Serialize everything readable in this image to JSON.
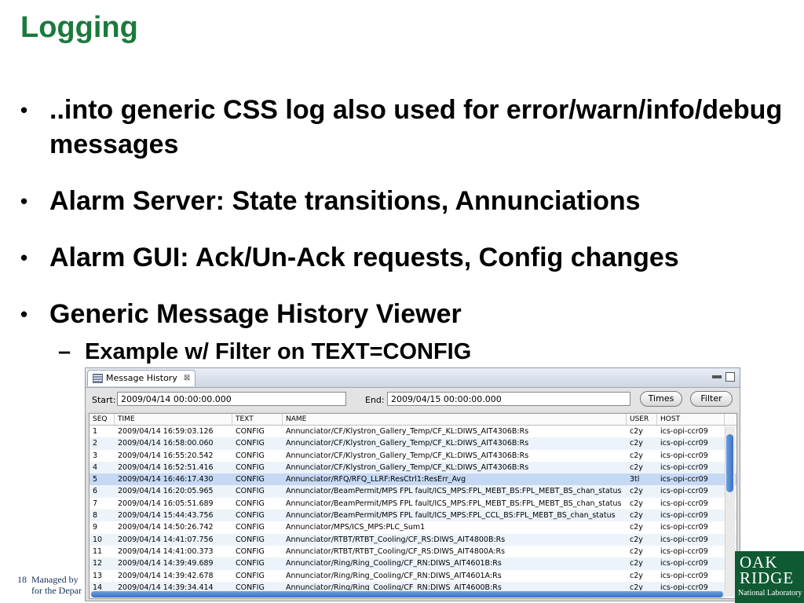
{
  "slide": {
    "title": "Logging",
    "bullets": [
      "..into generic CSS log also used for error/warn/info/debug messages",
      "Alarm Server: State transitions, Annunciations",
      "Alarm GUI: Ack/Un-Ack requests, Config changes",
      "Generic Message History Viewer"
    ],
    "sub_bullet": "Example w/ Filter on TEXT=CONFIG",
    "bullet_glyph": "•",
    "dash_glyph": "–"
  },
  "footer": {
    "page_number": "18",
    "line1": "Managed by",
    "line2": "for the Depar"
  },
  "logo": {
    "line1": "OAK",
    "line2": "RIDGE",
    "line3": "National Laboratory"
  },
  "window": {
    "tab_label": "Message History",
    "tab_close": "⊠",
    "start_label": "Start:",
    "start_value": "2009/04/14 00:00:00.000",
    "end_label": "End:",
    "end_value": "2009/04/15 00:00:00.000",
    "times_button": "Times",
    "filter_button": "Filter",
    "columns": [
      "SEQ",
      "TIME",
      "TEXT",
      "NAME",
      "USER",
      "HOST"
    ],
    "rows": [
      [
        "1",
        "2009/04/14 16:59:03.126",
        "CONFIG",
        "Annunciator/CF/Klystron_Gallery_Temp/CF_KL:DIWS_AIT4306B:Rs",
        "c2y",
        "ics-opi-ccr09"
      ],
      [
        "2",
        "2009/04/14 16:58:00.060",
        "CONFIG",
        "Annunciator/CF/Klystron_Gallery_Temp/CF_KL:DIWS_AIT4306B:Rs",
        "c2y",
        "ics-opi-ccr09"
      ],
      [
        "3",
        "2009/04/14 16:55:20.542",
        "CONFIG",
        "Annunciator/CF/Klystron_Gallery_Temp/CF_KL:DIWS_AIT4306B:Rs",
        "c2y",
        "ics-opi-ccr09"
      ],
      [
        "4",
        "2009/04/14 16:52:51.416",
        "CONFIG",
        "Annunciator/CF/Klystron_Gallery_Temp/CF_KL:DIWS_AIT4306B:Rs",
        "c2y",
        "ics-opi-ccr09"
      ],
      [
        "5",
        "2009/04/14 16:46:17.430",
        "CONFIG",
        "Annunciator/RFQ/RFQ_LLRF:ResCtrl1:ResErr_Avg",
        "3tl",
        "ics-opi-ccr09"
      ],
      [
        "6",
        "2009/04/14 16:20:05.965",
        "CONFIG",
        "Annunciator/BeamPermit/MPS FPL fault/ICS_MPS:FPL_MEBT_BS:FPL_MEBT_BS_chan_status",
        "c2y",
        "ics-opi-ccr09"
      ],
      [
        "7",
        "2009/04/14 16:05:51.689",
        "CONFIG",
        "Annunciator/BeamPermit/MPS FPL fault/ICS_MPS:FPL_MEBT_BS:FPL_MEBT_BS_chan_status",
        "c2y",
        "ics-opi-ccr09"
      ],
      [
        "8",
        "2009/04/14 15:44:43.756",
        "CONFIG",
        "Annunciator/BeamPermit/MPS FPL fault/ICS_MPS:FPL_CCL_BS:FPL_MEBT_BS_chan_status",
        "c2y",
        "ics-opi-ccr09"
      ],
      [
        "9",
        "2009/04/14 14:50:26.742",
        "CONFIG",
        "Annunciator/MPS/ICS_MPS:PLC_Sum1",
        "c2y",
        "ics-opi-ccr09"
      ],
      [
        "10",
        "2009/04/14 14:41:07.756",
        "CONFIG",
        "Annunciator/RTBT/RTBT_Cooling/CF_RS:DIWS_AIT4800B:Rs",
        "c2y",
        "ics-opi-ccr09"
      ],
      [
        "11",
        "2009/04/14 14:41:00.373",
        "CONFIG",
        "Annunciator/RTBT/RTBT_Cooling/CF_RS:DIWS_AIT4800A:Rs",
        "c2y",
        "ics-opi-ccr09"
      ],
      [
        "12",
        "2009/04/14 14:39:49.689",
        "CONFIG",
        "Annunciator/Ring/Ring_Cooling/CF_RN:DIWS_AIT4601B:Rs",
        "c2y",
        "ics-opi-ccr09"
      ],
      [
        "13",
        "2009/04/14 14:39:42.678",
        "CONFIG",
        "Annunciator/Ring/Ring_Cooling/CF_RN:DIWS_AIT4601A:Rs",
        "c2y",
        "ics-opi-ccr09"
      ],
      [
        "14",
        "2009/04/14 14:39:34.414",
        "CONFIG",
        "Annunciator/Ring/Ring_Cooling/CF_RN:DIWS_AIT4600B:Rs",
        "c2y",
        "ics-opi-ccr09"
      ]
    ],
    "selected_row_seq": "5",
    "colors": {
      "title_green": "#1b7a3c",
      "selection": "#c6d9f4",
      "scroll_blue": "#3a72c4"
    }
  }
}
